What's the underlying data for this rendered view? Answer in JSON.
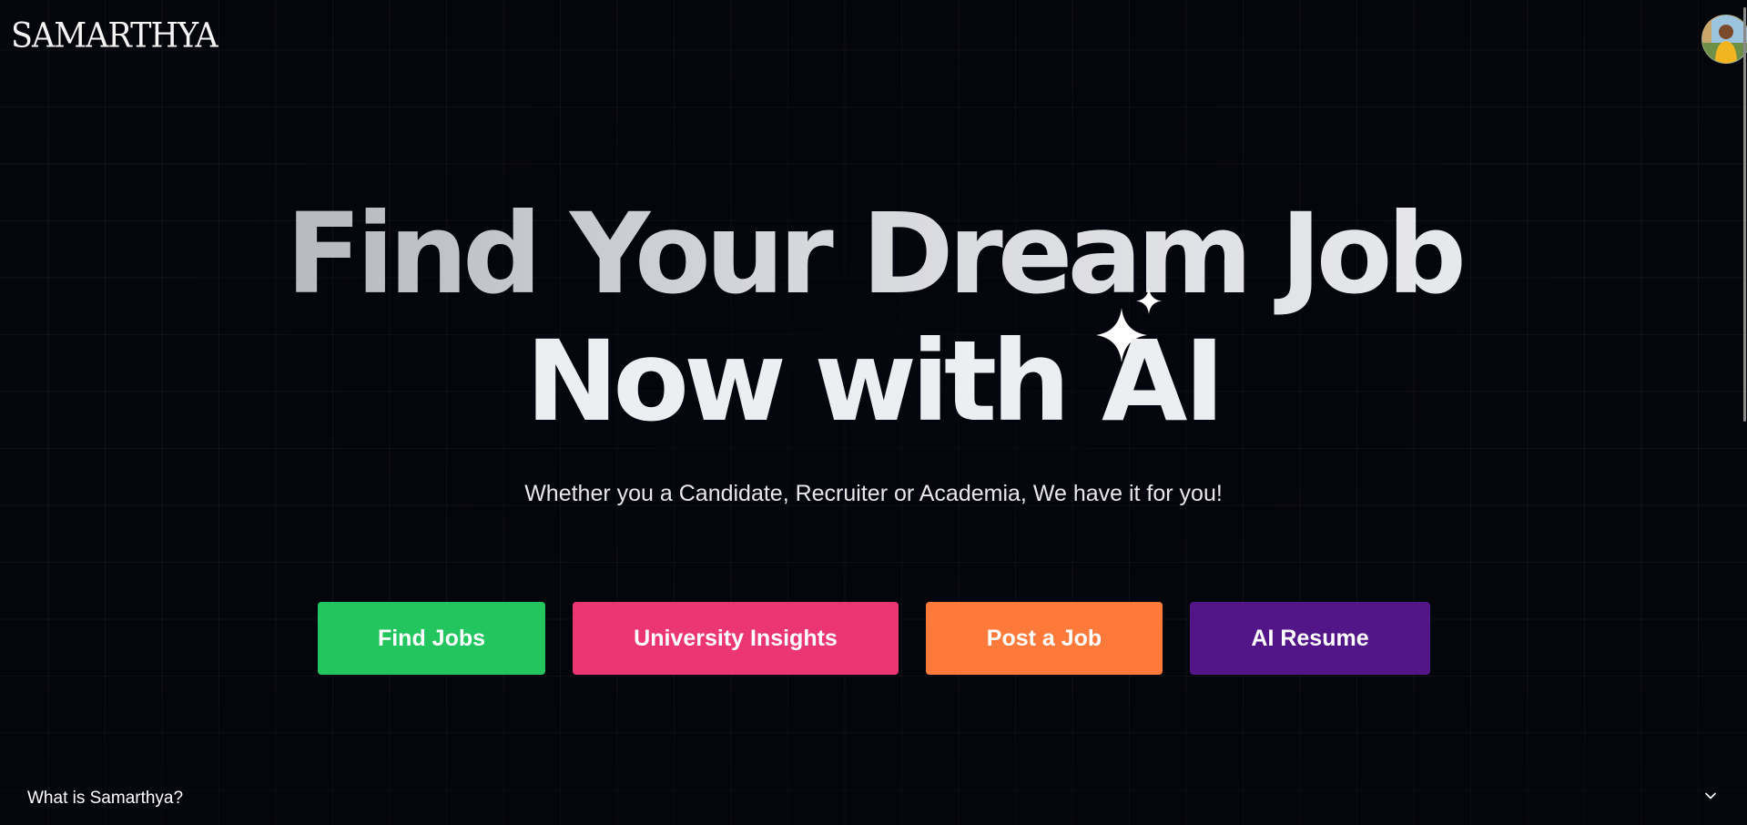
{
  "header": {
    "brand": "SAMARTHYA",
    "avatar_icon": "user-avatar"
  },
  "hero": {
    "title_line1": "Find Your Dream Job",
    "title_line2": "Now with",
    "title_ai": "AI",
    "subtitle": "Whether you a Candidate, Recruiter or Academia, We have it for you!"
  },
  "actions": {
    "find_jobs": "Find Jobs",
    "university_insights": "University Insights",
    "post_job": "Post a Job",
    "ai_resume": "AI Resume"
  },
  "colors": {
    "find_jobs": "#22c55e",
    "university_insights": "#ec3674",
    "post_job": "#fe7a3a",
    "ai_resume": "#531688",
    "background": "#05060c"
  },
  "faq": {
    "question": "What is Samarthya?",
    "toggle_icon": "chevron-down-icon"
  }
}
